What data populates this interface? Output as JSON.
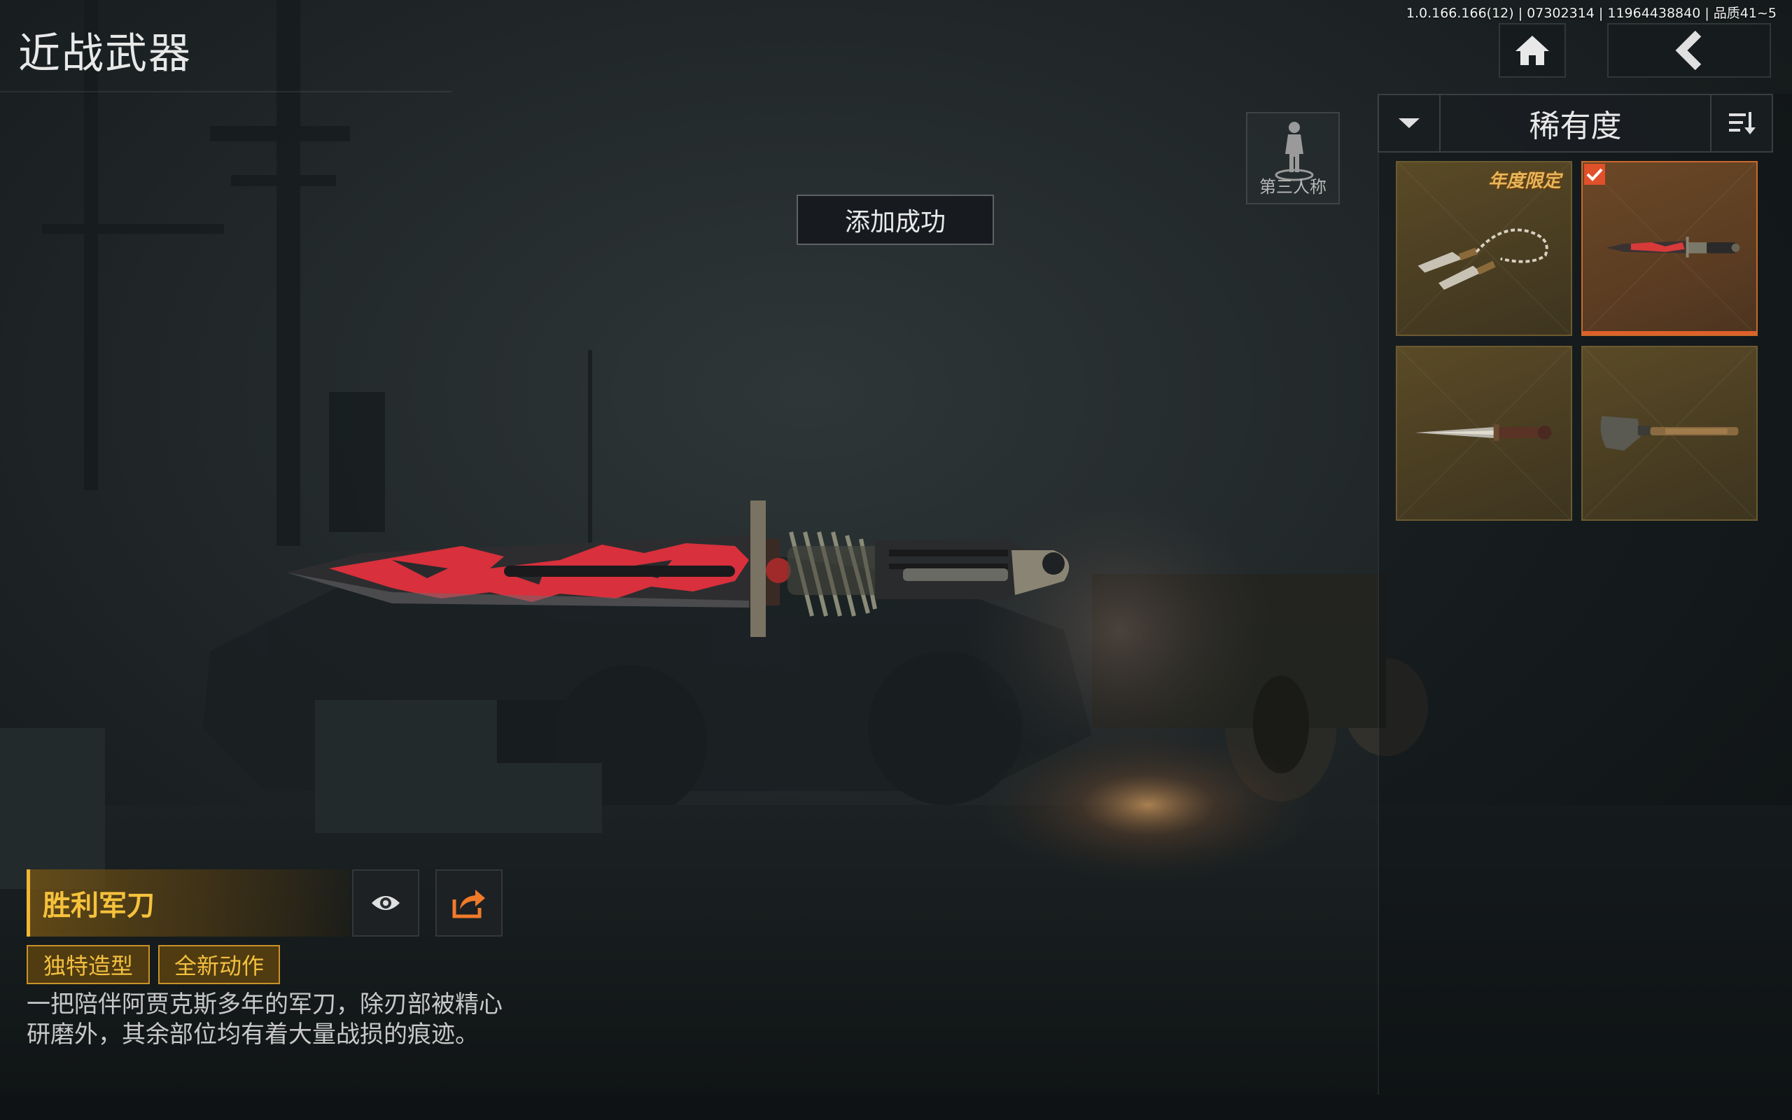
{
  "header": {
    "title": "近战武器",
    "version": "1.0.166.166(12) | 07302314 | 11964438840 | 品质41~5"
  },
  "nav": {
    "home_icon": "home-icon",
    "back_icon": "chevron-left-icon"
  },
  "view_toggle": {
    "label": "第三人称",
    "icon": "person-figure-icon"
  },
  "toast": {
    "message": "添加成功"
  },
  "sort": {
    "label": "稀有度",
    "dropdown_icon": "chevron-down-icon",
    "order_icon": "sort-order-icon"
  },
  "items": [
    {
      "badge": "年度限定",
      "art": "twin-kunai-chain",
      "selected": false
    },
    {
      "badge": "",
      "art": "victory-knife-red",
      "selected": true
    },
    {
      "badge": "",
      "art": "dagger",
      "selected": false
    },
    {
      "badge": "",
      "art": "shovel",
      "selected": false
    }
  ],
  "selected_item": {
    "name": "胜利军刀",
    "tags": [
      "独特造型",
      "全新动作"
    ],
    "description": "一把陪伴阿贾克斯多年的军刀，除刃部被精心研磨外，其余部位均有着大量战损的痕迹。"
  },
  "colors": {
    "accent_gold": "#f2b534",
    "selected_orange": "#e0602a",
    "card_gold": "#5a4a26",
    "knife_red": "#e0303a"
  }
}
